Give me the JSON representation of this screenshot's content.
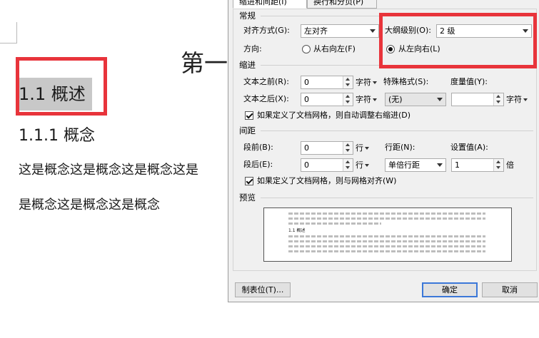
{
  "document": {
    "chapter_heading": "第一",
    "heading2": "1.1  概述",
    "heading3": "1.1.1  概念",
    "paragraph_line1": "这是概念这是概念这是概念这是",
    "paragraph_line2": "是概念这是概念这是概念"
  },
  "dialog": {
    "tabs": [
      "缩进和间距(I)",
      "换行和分页(P)"
    ],
    "active_tab": 0,
    "general": {
      "title": "常规",
      "alignment_label": "对齐方式(G):",
      "alignment_value": "左对齐",
      "outline_label": "大纲级别(O):",
      "outline_value": "2 级",
      "direction_label": "方向:",
      "rtl_label": "从右向左(F)",
      "ltr_label": "从左向右(L)",
      "direction_selected": "ltr"
    },
    "indent": {
      "title": "缩进",
      "before_label": "文本之前(R):",
      "before_value": "0",
      "before_unit": "字符",
      "after_label": "文本之后(X):",
      "after_value": "0",
      "after_unit": "字符",
      "special_label": "特殊格式(S):",
      "special_value": "(无)",
      "measure_label": "度量值(Y):",
      "measure_value": "",
      "measure_unit": "字符",
      "auto_adjust_label": "如果定义了文档网格，则自动调整右缩进(D)",
      "auto_adjust_checked": true
    },
    "spacing": {
      "title": "间距",
      "before_label": "段前(B):",
      "before_value": "0",
      "before_unit": "行",
      "after_label": "段后(E):",
      "after_value": "0",
      "after_unit": "行",
      "line_label": "行距(N):",
      "line_value": "单倍行距",
      "setting_label": "设置值(A):",
      "setting_value": "1",
      "setting_unit": "倍",
      "snap_grid_label": "如果定义了文档网格，则与网格对齐(W)",
      "snap_grid_checked": true
    },
    "preview": {
      "title": "预览",
      "sample_text": "1.1 概述"
    },
    "buttons": {
      "tabs_button": "制表位(T)...",
      "ok": "确定",
      "cancel": "取消"
    }
  }
}
